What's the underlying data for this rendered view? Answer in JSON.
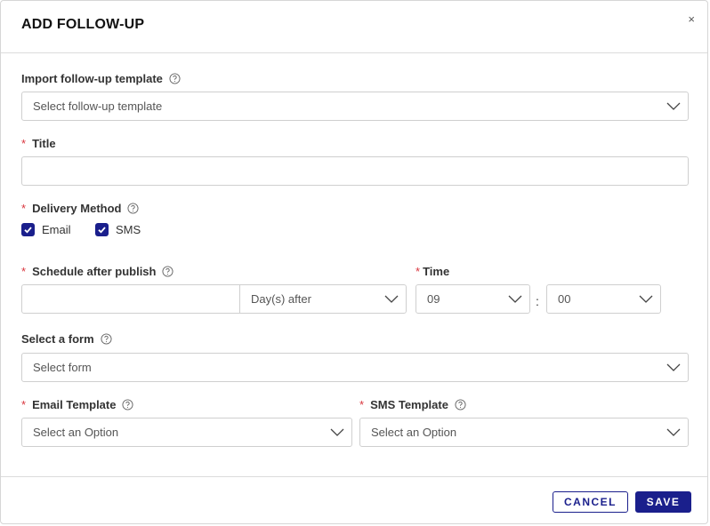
{
  "modal": {
    "title": "ADD FOLLOW-UP",
    "close_label": "×"
  },
  "import_template": {
    "label": "Import follow-up template",
    "placeholder": "Select follow-up template"
  },
  "title_field": {
    "label": "Title",
    "value": ""
  },
  "delivery_method": {
    "label": "Delivery Method",
    "options": [
      {
        "label": "Email",
        "checked": true
      },
      {
        "label": "SMS",
        "checked": true
      }
    ]
  },
  "schedule": {
    "label": "Schedule after publish",
    "value": "",
    "unit": "Day(s) after"
  },
  "time": {
    "label": "Time",
    "hour": "09",
    "separator": ":",
    "minute": "00"
  },
  "form": {
    "label": "Select a form",
    "placeholder": "Select form"
  },
  "email_template": {
    "label": "Email Template",
    "placeholder": "Select an Option"
  },
  "sms_template": {
    "label": "SMS Template",
    "placeholder": "Select an Option"
  },
  "required_mark": "*",
  "actions": {
    "cancel": "CANCEL",
    "save": "SAVE"
  },
  "colors": {
    "accent": "#1a1f8c",
    "required": "#d9363e"
  },
  "icons": {
    "help": "question-circle-icon",
    "dropdown": "chevron-down-icon",
    "check": "check-icon",
    "close": "close-icon"
  }
}
